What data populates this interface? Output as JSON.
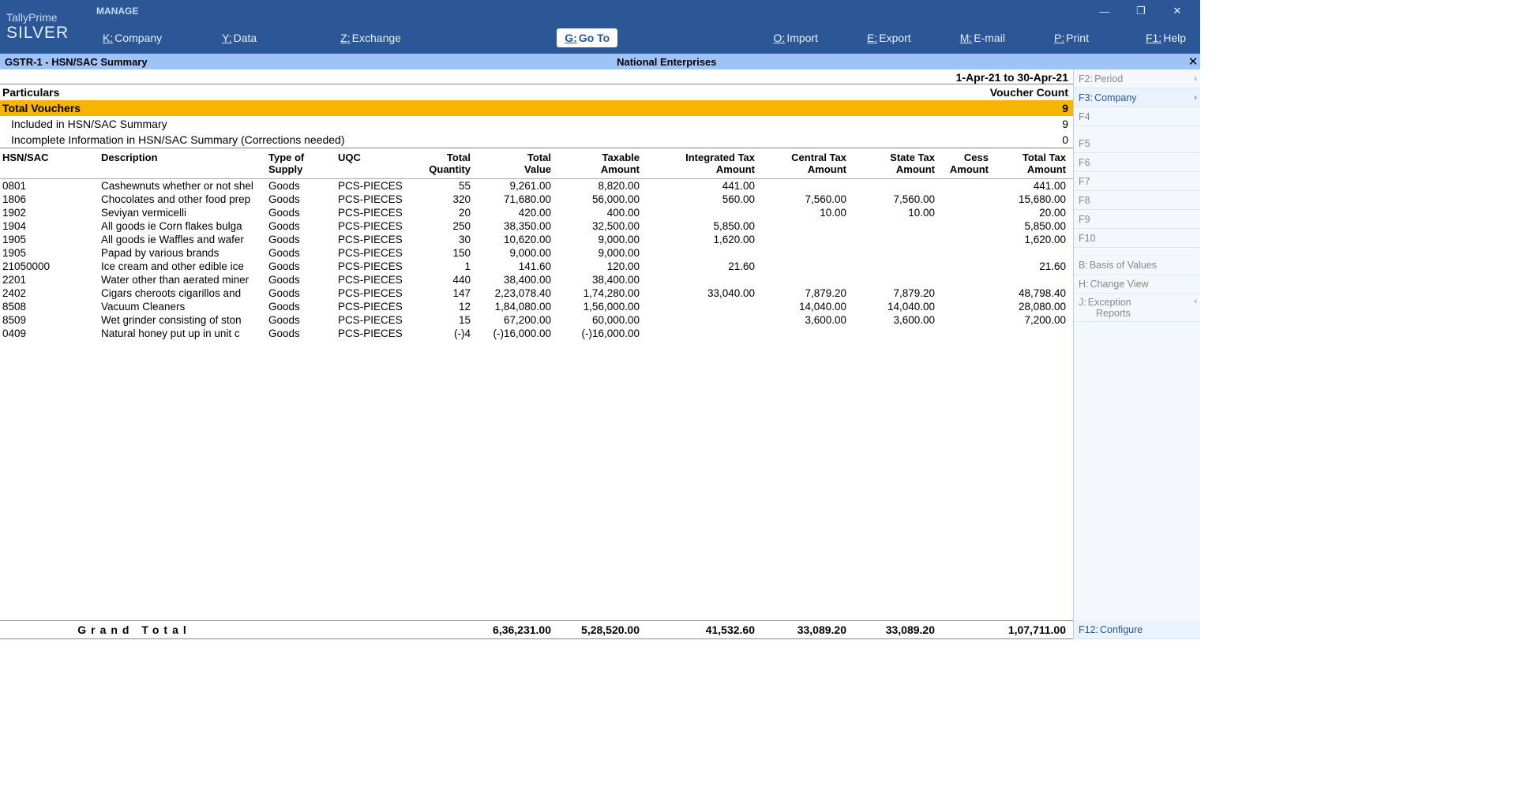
{
  "app": {
    "name_top": "TallyPrime",
    "name_bottom": "SILVER",
    "manage": "MANAGE"
  },
  "menubar": {
    "company": {
      "k": "K:",
      "t": "Company"
    },
    "data": {
      "k": "Y:",
      "t": "Data"
    },
    "exchange": {
      "k": "Z:",
      "t": "Exchange"
    },
    "goto": {
      "k": "G:",
      "t": "Go To"
    },
    "import": {
      "k": "O:",
      "t": "Import"
    },
    "export": {
      "k": "E:",
      "t": "Export"
    },
    "email": {
      "k": "M:",
      "t": "E-mail"
    },
    "print": {
      "k": "P:",
      "t": "Print"
    },
    "help": {
      "k": "F1:",
      "t": "Help"
    }
  },
  "subheader": {
    "left": "GSTR-1  -  HSN/SAC Summary",
    "center": "National Enterprises",
    "close": "✕"
  },
  "period": "1-Apr-21 to 30-Apr-21",
  "headers": {
    "particulars": "Particulars",
    "vcount": "Voucher Count",
    "total_vouchers": "Total Vouchers",
    "total_vouchers_n": "9",
    "included": "Included in HSN/SAC Summary",
    "included_n": "9",
    "incomplete": "Incomplete Information in HSN/SAC Summary (Corrections needed)",
    "incomplete_n": "0"
  },
  "cols": {
    "hsn": "HSN/SAC",
    "desc": "Description",
    "type": "Type of",
    "type2": "Supply",
    "uqc": "UQC",
    "qty": "Total",
    "qty2": "Quantity",
    "val": "Total",
    "val2": "Value",
    "tax": "Taxable",
    "tax2": "Amount",
    "igst": "Integrated Tax",
    "igst2": "Amount",
    "cgst": "Central Tax",
    "cgst2": "Amount",
    "sgst": "State Tax",
    "sgst2": "Amount",
    "cess": "Cess",
    "cess2": "Amount",
    "tot": "Total Tax",
    "tot2": "Amount"
  },
  "rows": [
    {
      "hsn": "0801",
      "desc": "Cashewnuts whether or not shel",
      "type": "Goods",
      "uqc": "PCS-PIECES",
      "qty": "55",
      "val": "9,261.00",
      "tax": "8,820.00",
      "igst": "441.00",
      "cgst": "",
      "sgst": "",
      "cess": "",
      "tot": "441.00"
    },
    {
      "hsn": "1806",
      "desc": "Chocolates and other food prep",
      "type": "Goods",
      "uqc": "PCS-PIECES",
      "qty": "320",
      "val": "71,680.00",
      "tax": "56,000.00",
      "igst": "560.00",
      "cgst": "7,560.00",
      "sgst": "7,560.00",
      "cess": "",
      "tot": "15,680.00"
    },
    {
      "hsn": "1902",
      "desc": "Seviyan vermicelli",
      "type": "Goods",
      "uqc": "PCS-PIECES",
      "qty": "20",
      "val": "420.00",
      "tax": "400.00",
      "igst": "",
      "cgst": "10.00",
      "sgst": "10.00",
      "cess": "",
      "tot": "20.00"
    },
    {
      "hsn": "1904",
      "desc": "All goods ie Corn flakes bulga",
      "type": "Goods",
      "uqc": "PCS-PIECES",
      "qty": "250",
      "val": "38,350.00",
      "tax": "32,500.00",
      "igst": "5,850.00",
      "cgst": "",
      "sgst": "",
      "cess": "",
      "tot": "5,850.00"
    },
    {
      "hsn": "1905",
      "desc": "All goods ie Waffles and wafer",
      "type": "Goods",
      "uqc": "PCS-PIECES",
      "qty": "30",
      "val": "10,620.00",
      "tax": "9,000.00",
      "igst": "1,620.00",
      "cgst": "",
      "sgst": "",
      "cess": "",
      "tot": "1,620.00"
    },
    {
      "hsn": "1905",
      "desc": "Papad by various brands",
      "type": "Goods",
      "uqc": "PCS-PIECES",
      "qty": "150",
      "val": "9,000.00",
      "tax": "9,000.00",
      "igst": "",
      "cgst": "",
      "sgst": "",
      "cess": "",
      "tot": ""
    },
    {
      "hsn": "21050000",
      "desc": "Ice cream and other edible ice",
      "type": "Goods",
      "uqc": "PCS-PIECES",
      "qty": "1",
      "val": "141.60",
      "tax": "120.00",
      "igst": "21.60",
      "cgst": "",
      "sgst": "",
      "cess": "",
      "tot": "21.60"
    },
    {
      "hsn": "2201",
      "desc": "Water other than aerated miner",
      "type": "Goods",
      "uqc": "PCS-PIECES",
      "qty": "440",
      "val": "38,400.00",
      "tax": "38,400.00",
      "igst": "",
      "cgst": "",
      "sgst": "",
      "cess": "",
      "tot": ""
    },
    {
      "hsn": "2402",
      "desc": "Cigars cheroots cigarillos and",
      "type": "Goods",
      "uqc": "PCS-PIECES",
      "qty": "147",
      "val": "2,23,078.40",
      "tax": "1,74,280.00",
      "igst": "33,040.00",
      "cgst": "7,879.20",
      "sgst": "7,879.20",
      "cess": "",
      "tot": "48,798.40"
    },
    {
      "hsn": "8508",
      "desc": "Vacuum Cleaners",
      "type": "Goods",
      "uqc": "PCS-PIECES",
      "qty": "12",
      "val": "1,84,080.00",
      "tax": "1,56,000.00",
      "igst": "",
      "cgst": "14,040.00",
      "sgst": "14,040.00",
      "cess": "",
      "tot": "28,080.00"
    },
    {
      "hsn": "8509",
      "desc": "Wet grinder consisting of ston",
      "type": "Goods",
      "uqc": "PCS-PIECES",
      "qty": "15",
      "val": "67,200.00",
      "tax": "60,000.00",
      "igst": "",
      "cgst": "3,600.00",
      "sgst": "3,600.00",
      "cess": "",
      "tot": "7,200.00"
    },
    {
      "hsn": "0409",
      "desc": "Natural honey put up in unit c",
      "type": "Goods",
      "uqc": "PCS-PIECES",
      "qty": "(-)4",
      "val": "(-)16,000.00",
      "tax": "(-)16,000.00",
      "igst": "",
      "cgst": "",
      "sgst": "",
      "cess": "",
      "tot": ""
    }
  ],
  "grand": {
    "label": "Grand Total",
    "val": "6,36,231.00",
    "tax": "5,28,520.00",
    "igst": "41,532.60",
    "cgst": "33,089.20",
    "sgst": "33,089.20",
    "cess": "",
    "tot": "1,07,711.00"
  },
  "side": {
    "f2": {
      "k": "F2:",
      "t": "Period"
    },
    "f3": {
      "k": "F3:",
      "t": "Company"
    },
    "f4": {
      "k": "F4"
    },
    "f5": {
      "k": "F5"
    },
    "f6": {
      "k": "F6"
    },
    "f7": {
      "k": "F7"
    },
    "f8": {
      "k": "F8"
    },
    "f9": {
      "k": "F9"
    },
    "f10": {
      "k": "F10"
    },
    "b": {
      "k": "B:",
      "t": "Basis of Values"
    },
    "h": {
      "k": "H:",
      "t": "Change View"
    },
    "j": {
      "k": "J:",
      "t": "Exception",
      "t2": "Reports"
    },
    "f12": {
      "k": "F12:",
      "t": "Configure"
    }
  }
}
